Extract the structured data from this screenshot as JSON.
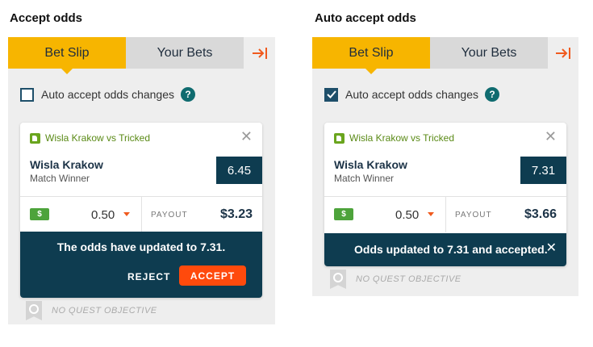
{
  "left": {
    "heading": "Accept odds",
    "tabs": {
      "bet_slip": "Bet Slip",
      "your_bets": "Your Bets"
    },
    "auto_accept_label": "Auto accept odds changes",
    "auto_accept_checked": false,
    "help_glyph": "?",
    "match": "Wisla Krakow vs Tricked",
    "selection": "Wisla Krakow",
    "market": "Match Winner",
    "odds": "6.45",
    "money_glyph": "$",
    "stake": "0.50",
    "payout_label": "PAYOUT",
    "payout_value": "$3.23",
    "notice": "The odds have updated to 7.31.",
    "reject_label": "REJECT",
    "accept_label": "ACCEPT",
    "quest": "NO QUEST OBJECTIVE"
  },
  "right": {
    "heading": "Auto accept odds",
    "tabs": {
      "bet_slip": "Bet Slip",
      "your_bets": "Your Bets"
    },
    "auto_accept_label": "Auto accept odds changes",
    "auto_accept_checked": true,
    "help_glyph": "?",
    "match": "Wisla Krakow vs Tricked",
    "selection": "Wisla Krakow",
    "market": "Match Winner",
    "odds": "7.31",
    "money_glyph": "$",
    "stake": "0.50",
    "payout_label": "PAYOUT",
    "payout_value": "$3.66",
    "notice": "Odds updated to 7.31 and accepted.",
    "quest": "NO QUEST OBJECTIVE"
  },
  "colors": {
    "active_tab": "#f7b500",
    "dark_teal": "#0e3c50",
    "accept_button": "#ff4a0c",
    "match_green": "#5a8a16"
  },
  "icons": {
    "collapse": "collapse-right-icon",
    "close": "close-icon",
    "help": "help-icon",
    "money": "money-icon",
    "quest": "quest-badge-icon"
  }
}
